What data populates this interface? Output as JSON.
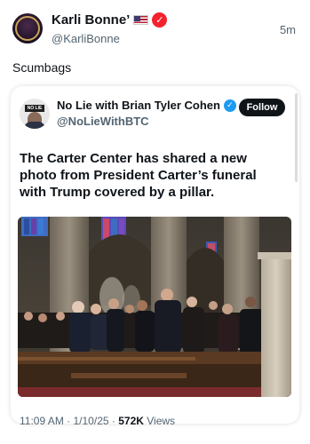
{
  "post": {
    "display_name": "Karli Bonne’",
    "flag_icon": "us-flag-icon",
    "badge_icon": "verified-red-icon",
    "handle": "@KarliBonne",
    "time_ago": "5m",
    "text": "Scumbags"
  },
  "quote": {
    "display_name": "No Lie with Brian Tyler Cohen",
    "badge_icon": "verified-blue-icon",
    "handle": "@NoLieWithBTC",
    "follow_label": "Follow",
    "text": "The Carter Center has shared a new photo from President Carter’s funeral with Trump covered by a pillar.",
    "avatar_logo_text": "NO LIE",
    "photo_icon": "funeral-photo",
    "time": "11:09 AM",
    "separator": "·",
    "date": "1/10/25",
    "views_count": "572K",
    "views_label": "Views"
  },
  "colors": {
    "text_primary": "#0f1419",
    "text_secondary": "#536471",
    "verified_blue": "#1d9bf0",
    "verified_red": "#f4212e",
    "follow_bg": "#0f1419"
  }
}
